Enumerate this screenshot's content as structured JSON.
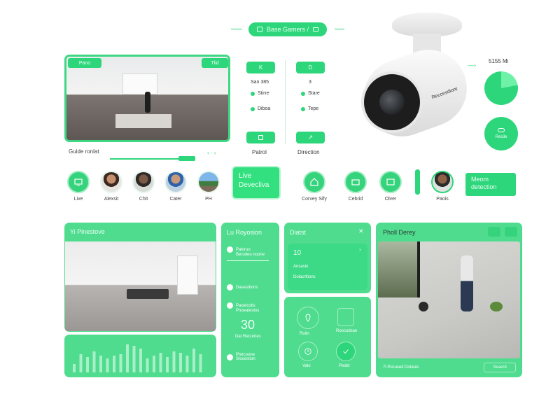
{
  "header": {
    "title": "Base Gamers /"
  },
  "top_left_panel": {
    "badge_left": "Pano",
    "badge_right": "Tlid",
    "caption": "Guide ronlat"
  },
  "controls": {
    "btn1": "K",
    "btn2": "D",
    "stat1": "San 385",
    "stat1b": "3",
    "item1": "Stirre",
    "item2": "Stare",
    "item3": "Diboa",
    "item4": "Tepe",
    "label_patrol": "Patrol",
    "label_direction": "Direction"
  },
  "camera": {
    "brand": "Reccesdiont"
  },
  "pie": {
    "value": "5155 Mi",
    "fraction": 0.22,
    "circle_label": "Recile"
  },
  "quick_row": {
    "items": [
      {
        "label": "Live"
      },
      {
        "label": "Alexsit"
      },
      {
        "label": "Chit"
      },
      {
        "label": "Cater"
      },
      {
        "label": "PH"
      }
    ],
    "live_button_line1": "Live",
    "live_button_line2": "Devecliva",
    "right_items": [
      {
        "label": "Corvey Sify"
      },
      {
        "label": "Cebrid"
      },
      {
        "label": "Olver"
      },
      {
        "label": "Paois"
      }
    ],
    "motion_line1": "Meom",
    "motion_line2": "detection"
  },
  "bottom": {
    "panel1_title": "Yi Pinestove",
    "panel2_title": "Lu Royosion",
    "panel2_items": [
      {
        "title": "Paloruo",
        "sub": "Berudeu noone"
      },
      {
        "title": "Dasesttions",
        "sub": ""
      },
      {
        "title": "Paoelcotis",
        "sub": "Pnoeatestos"
      }
    ],
    "panel2_big": "30",
    "panel2_big_sub": "Dat Recurries",
    "panel2_footer": "Plercoone Slocestion",
    "panel3_title": "Diatst",
    "panel3_card_value": "10",
    "panel3_card_line1": "Ansasio",
    "panel3_card_line2": "Dolacrttions",
    "panel3_icon1_label": "Ruiin",
    "panel3_icon2_label": "Roocodsan",
    "panel3_icon3_label": "Valo",
    "panel3_icon4_label": "Pedet",
    "panel4_title": "Pholl Derey",
    "panel4_footer_left": "7l Pucuseit Dotaois",
    "panel4_footer_btn": "Seaerd",
    "bars": [
      12,
      26,
      22,
      30,
      24,
      20,
      24,
      26,
      40,
      38,
      34,
      20,
      24,
      28,
      22,
      30,
      28,
      24,
      34,
      26
    ]
  },
  "colors": {
    "accent": "#2ed67b",
    "accent_light": "#a6eec5"
  }
}
